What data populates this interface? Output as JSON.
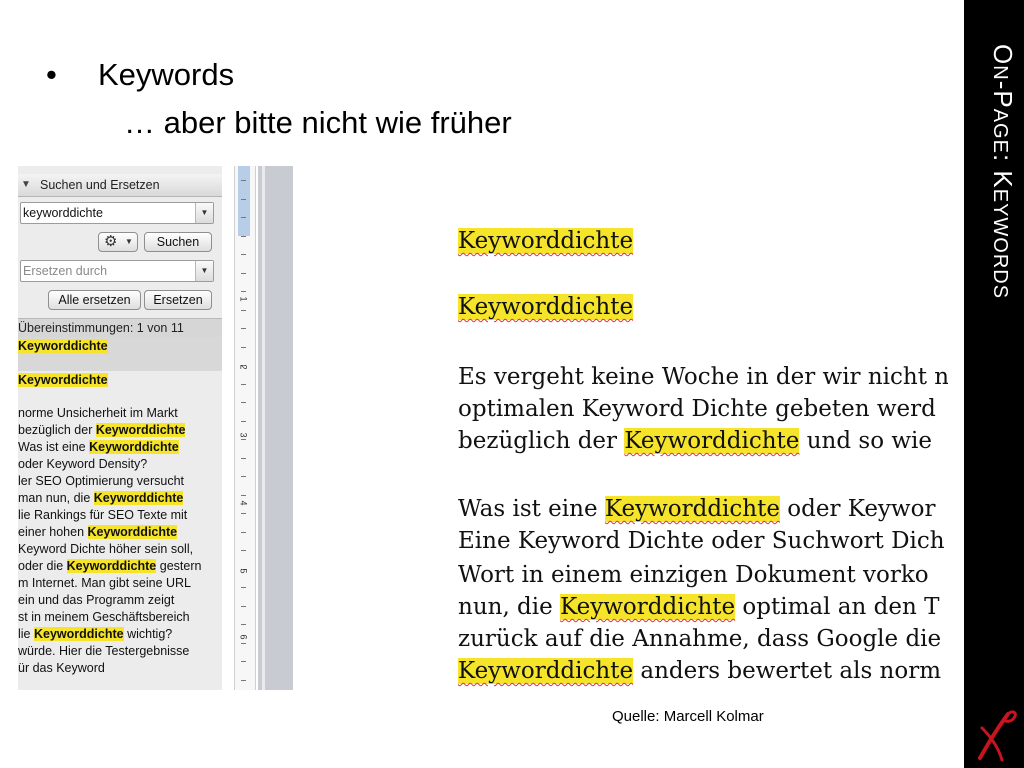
{
  "slide": {
    "bullet_symbol": "•",
    "bullet_text": "Keywords",
    "sub_text": "… aber bitte nicht wie früher",
    "side_title_parts": [
      "O",
      "N",
      "-P",
      "AGE",
      ": K",
      "EYWORDS"
    ],
    "source": "Quelle: Marcell Kolmar"
  },
  "search_panel": {
    "header": "Suchen und Ersetzen",
    "search_value": "keyworddichte",
    "search_button": "Suchen",
    "replace_placeholder": "Ersetzen durch",
    "replace_all_button": "Alle ersetzen",
    "replace_button": "Ersetzen",
    "matches_label": "Übereinstimmungen: 1 von 11",
    "results": [
      {
        "parts": [
          {
            "t": "Keyworddichte",
            "h": true
          }
        ]
      },
      {
        "parts": [
          {
            "t": "Keyworddichte",
            "h": true
          }
        ]
      },
      {
        "lines": [
          [
            {
              "t": "norme Unsicherheit im Markt",
              "h": false
            }
          ],
          [
            {
              "t": "bezüglich der ",
              "h": false
            },
            {
              "t": "Keyworddichte",
              "h": true
            }
          ]
        ]
      },
      {
        "lines": [
          [
            {
              "t": "Was ist eine ",
              "h": false
            },
            {
              "t": "Keyworddichte",
              "h": true
            }
          ],
          [
            {
              "t": "oder Keyword Density?",
              "h": false
            }
          ]
        ]
      },
      {
        "lines": [
          [
            {
              "t": "ler SEO Optimierung versucht",
              "h": false
            }
          ],
          [
            {
              "t": "man nun, die ",
              "h": false
            },
            {
              "t": "Keyworddichte",
              "h": true
            }
          ]
        ]
      },
      {
        "lines": [
          [
            {
              "t": "lie Rankings für SEO Texte mit",
              "h": false
            }
          ],
          [
            {
              "t": "einer hohen ",
              "h": false
            },
            {
              "t": "Keyworddichte",
              "h": true
            }
          ]
        ]
      },
      {
        "lines": [
          [
            {
              "t": "Keyword Dichte höher sein soll,",
              "h": false
            }
          ],
          [
            {
              "t": "oder die ",
              "h": false
            },
            {
              "t": "Keyworddichte",
              "h": true
            },
            {
              "t": " gestern",
              "h": false
            }
          ]
        ]
      },
      {
        "lines": [
          [
            {
              "t": "m Internet. Man gibt seine URL",
              "h": false
            }
          ],
          [
            {
              "t": "ein und das Programm zeigt",
              "h": false
            }
          ]
        ]
      },
      {
        "lines": [
          [
            {
              "t": "st in meinem Geschäftsbereich",
              "h": false
            }
          ],
          [
            {
              "t": "lie ",
              "h": false
            },
            {
              "t": "Keyworddichte",
              "h": true
            },
            {
              "t": " wichtig?",
              "h": false
            }
          ]
        ]
      },
      {
        "lines": [
          [
            {
              "t": "würde. Hier die Testergebnisse",
              "h": false
            }
          ],
          [
            {
              "t": "ür das Keyword",
              "h": false
            }
          ]
        ]
      }
    ],
    "ruler_numbers": [
      "1",
      "2",
      "3",
      "4",
      "5",
      "6"
    ]
  },
  "document": {
    "rows": [
      [
        {
          "t": "Keyworddichte",
          "h": true
        }
      ],
      [
        {
          "t": "Keyworddichte",
          "h": true
        }
      ],
      [
        {
          "t": "Es vergeht keine Woche in der wir nicht n",
          "h": false
        }
      ],
      [
        {
          "t": "optimalen Keyword Dichte gebeten werd",
          "h": false
        }
      ],
      [
        {
          "t": "bezüglich der ",
          "h": false
        },
        {
          "t": "Keyworddichte",
          "h": true
        },
        {
          "t": " und so wie",
          "h": false
        }
      ],
      [
        {
          "t": "Was ist eine ",
          "h": false
        },
        {
          "t": "Keyworddichte",
          "h": true
        },
        {
          "t": " oder Keywor",
          "h": false
        }
      ],
      [
        {
          "t": "Eine Keyword Dichte oder Suchwort Dich",
          "h": false
        }
      ],
      [
        {
          "t": "Wort in einem einzigen Dokument vorko",
          "h": false
        }
      ],
      [
        {
          "t": "nun, die ",
          "h": false
        },
        {
          "t": "Keyworddichte",
          "h": true
        },
        {
          "t": " optimal an den T",
          "h": false
        }
      ],
      [
        {
          "t": "zurück auf die Annahme, dass Google die",
          "h": false
        }
      ],
      [
        {
          "t": "Keyworddichte",
          "h": true
        },
        {
          "t": " anders bewertet als norm",
          "h": false
        }
      ]
    ]
  }
}
